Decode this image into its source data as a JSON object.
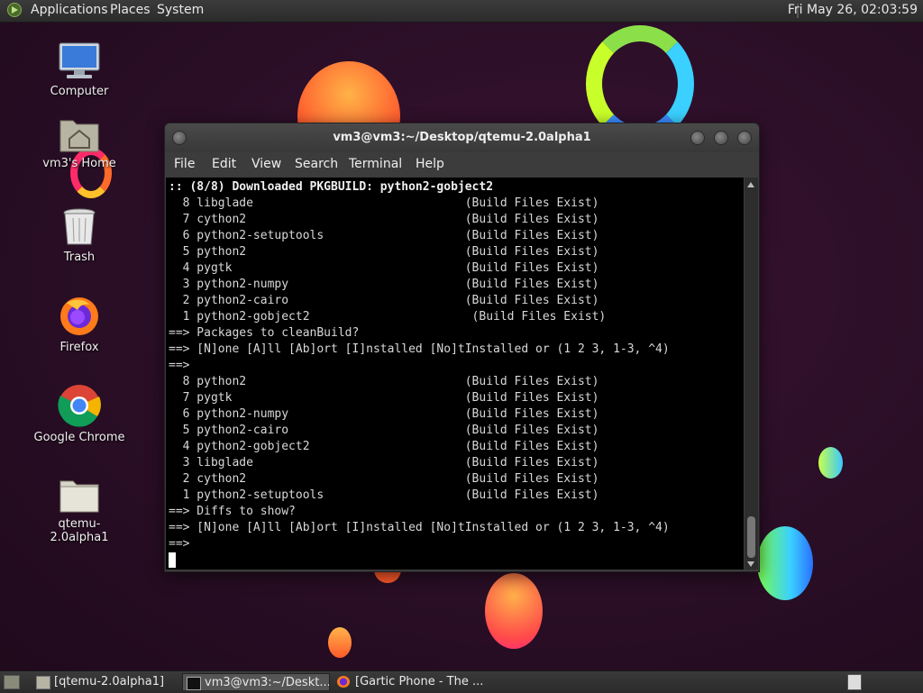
{
  "top_panel": {
    "menus": [
      "Applications",
      "Places",
      "System"
    ],
    "clock": "Fri May 26, 02:03:59"
  },
  "desktop_icons": [
    {
      "label": "Computer",
      "icon": "computer-icon"
    },
    {
      "label": "vm3's Home",
      "icon": "home-folder-icon"
    },
    {
      "label": "Trash",
      "icon": "trash-icon"
    },
    {
      "label": "Firefox",
      "icon": "firefox-icon"
    },
    {
      "label": "Google Chrome",
      "icon": "chrome-icon"
    },
    {
      "label": "qtemu-2.0alpha1",
      "icon": "folder-icon"
    }
  ],
  "window": {
    "title": "vm3@vm3:~/Desktop/qtemu-2.0alpha1",
    "menus": [
      "File",
      "Edit",
      "View",
      "Search",
      "Terminal",
      "Help"
    ]
  },
  "terminal": {
    "header": ":: (8/8) Downloaded PKGBUILD: python2-gobject2",
    "lines": [
      "  8 libglade                              (Build Files Exist)",
      "  7 cython2                               (Build Files Exist)",
      "  6 python2-setuptools                    (Build Files Exist)",
      "  5 python2                               (Build Files Exist)",
      "  4 pygtk                                 (Build Files Exist)",
      "  3 python2-numpy                         (Build Files Exist)",
      "  2 python2-cairo                         (Build Files Exist)",
      "  1 python2-gobject2                       (Build Files Exist)",
      "==> Packages to cleanBuild?",
      "==> [N]one [A]ll [Ab]ort [I]nstalled [No]tInstalled or (1 2 3, 1-3, ^4)",
      "==>",
      "  8 python2                               (Build Files Exist)",
      "  7 pygtk                                 (Build Files Exist)",
      "  6 python2-numpy                         (Build Files Exist)",
      "  5 python2-cairo                         (Build Files Exist)",
      "  4 python2-gobject2                      (Build Files Exist)",
      "  3 libglade                              (Build Files Exist)",
      "  2 cython2                               (Build Files Exist)",
      "  1 python2-setuptools                    (Build Files Exist)",
      "==> Diffs to show?",
      "==> [N]one [A]ll [Ab]ort [I]nstalled [No]tInstalled or (1 2 3, 1-3, ^4)",
      "==>"
    ]
  },
  "taskbar": {
    "tasks": [
      {
        "label": "[qtemu-2.0alpha1]",
        "icon": "folder-icon",
        "active": false
      },
      {
        "label": "vm3@vm3:~/Deskt...",
        "icon": "terminal-icon",
        "active": true
      },
      {
        "label": "[Gartic Phone - The ...",
        "icon": "firefox-icon",
        "active": false
      }
    ]
  },
  "colors": {
    "panel": "#2e2e2e",
    "terminal_bg": "#000000",
    "terminal_fg": "#d8d8d8",
    "desktop_bg": "#2a0f25"
  }
}
